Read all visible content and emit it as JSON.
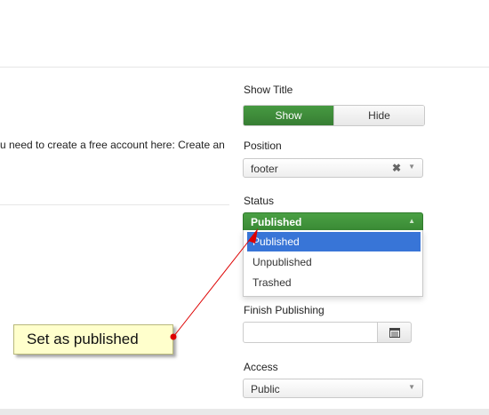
{
  "main": {
    "intro_text": "u need to create a free account here: Create an"
  },
  "show_title": {
    "label": "Show Title",
    "show_label": "Show",
    "hide_label": "Hide"
  },
  "position": {
    "label": "Position",
    "value": "footer",
    "clear_glyph": "✖",
    "arrow_glyph": "▼"
  },
  "status": {
    "label": "Status",
    "value": "Published",
    "arrow_glyph": "▲",
    "options": [
      "Published",
      "Unpublished",
      "Trashed"
    ]
  },
  "finish_publishing": {
    "label": "Finish Publishing",
    "value": ""
  },
  "access": {
    "label": "Access",
    "value": "Public",
    "arrow_glyph": "▼"
  },
  "annotation": {
    "text": "Set as published",
    "color": "#dd0000"
  },
  "colors": {
    "success_green": "#3e8b3a",
    "highlight_blue": "#3875d7",
    "callout_bg": "#ffffcc"
  }
}
